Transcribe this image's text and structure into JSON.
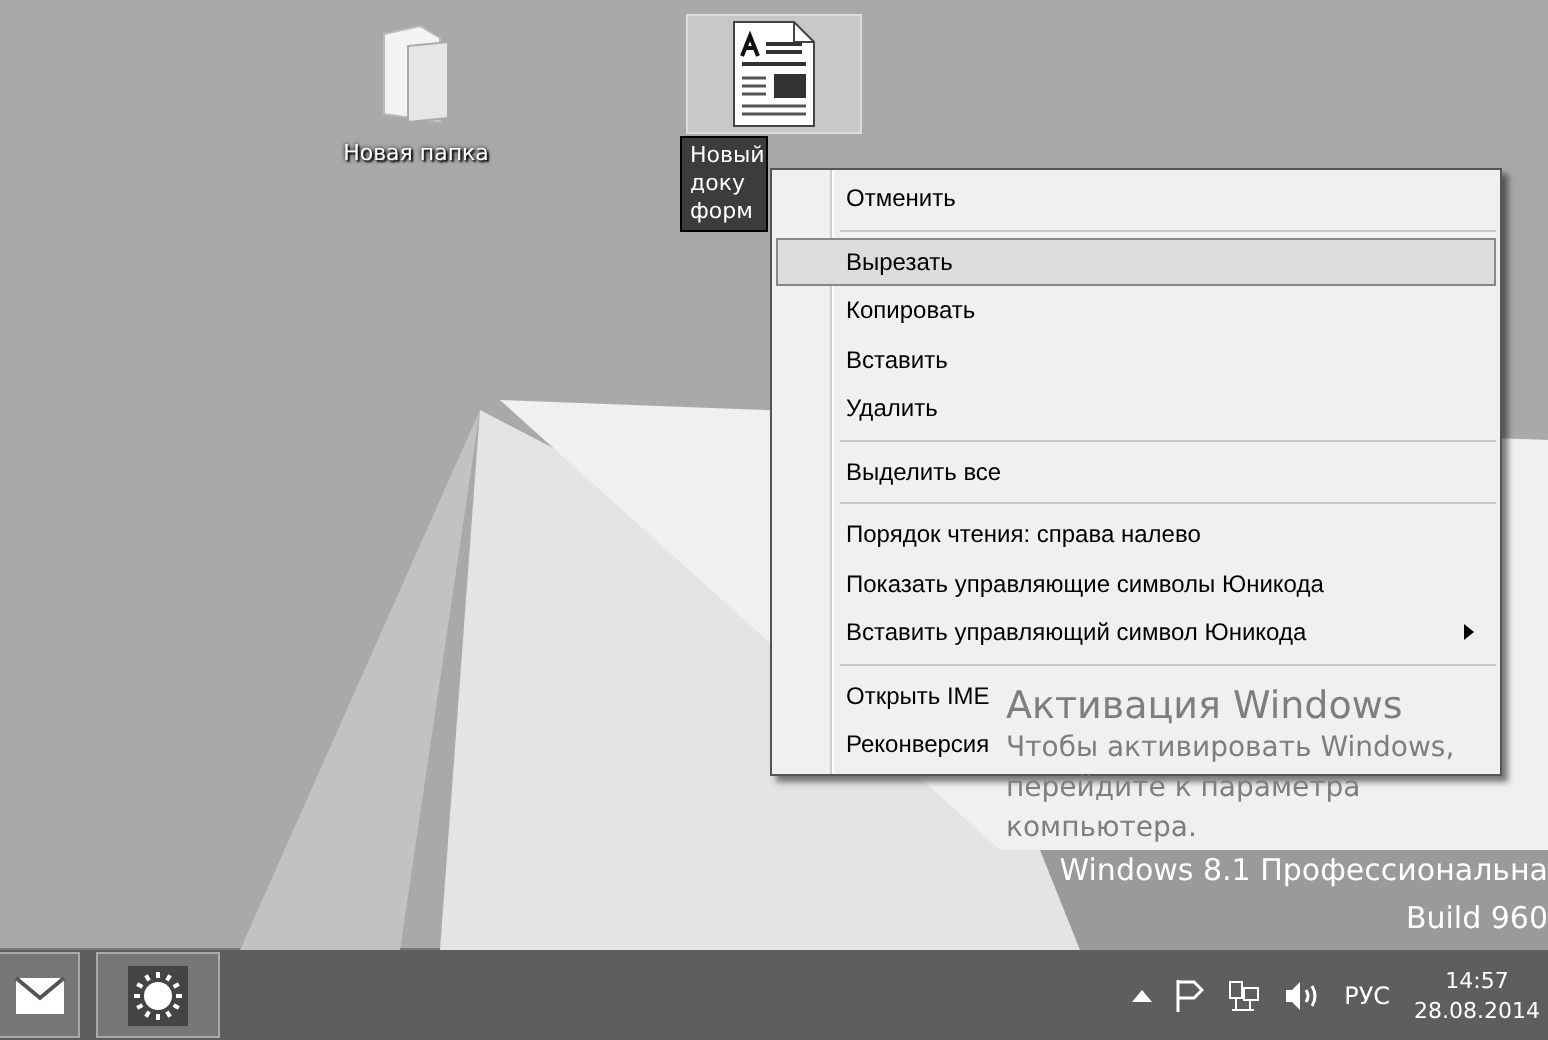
{
  "desktop": {
    "icons": [
      {
        "kind": "folder",
        "label": "Новая папка",
        "selected": false
      },
      {
        "kind": "document",
        "label": "Новый доку форм",
        "selected": true
      }
    ],
    "activation": {
      "title": "Активация Windows",
      "lines": [
        "Чтобы активировать Windows,",
        "перейдите к параметра",
        "компьютера."
      ]
    },
    "edition": {
      "name": "Windows 8.1 Профессиональна",
      "build": "Build 960"
    }
  },
  "context_menu": {
    "items": [
      {
        "kind": "item",
        "label": "Отменить",
        "selected": false,
        "submenu": false
      },
      {
        "kind": "separator"
      },
      {
        "kind": "item",
        "label": "Вырезать",
        "selected": true,
        "submenu": false
      },
      {
        "kind": "item",
        "label": "Копировать",
        "selected": false,
        "submenu": false
      },
      {
        "kind": "item",
        "label": "Вставить",
        "selected": false,
        "submenu": false
      },
      {
        "kind": "item",
        "label": "Удалить",
        "selected": false,
        "submenu": false
      },
      {
        "kind": "separator"
      },
      {
        "kind": "item",
        "label": "Выделить все",
        "selected": false,
        "submenu": false
      },
      {
        "kind": "separator"
      },
      {
        "kind": "item",
        "label": "Порядок чтения: справа налево",
        "selected": false,
        "submenu": false
      },
      {
        "kind": "item",
        "label": "Показать управляющие символы Юникода",
        "selected": false,
        "submenu": false
      },
      {
        "kind": "item",
        "label": "Вставить управляющий символ Юникода",
        "selected": false,
        "submenu": true
      },
      {
        "kind": "separator"
      },
      {
        "kind": "item",
        "label": "Открыть IME",
        "selected": false,
        "submenu": false
      },
      {
        "kind": "item",
        "label": "Реконверсия",
        "selected": false,
        "submenu": false
      }
    ]
  },
  "taskbar": {
    "apps": [
      {
        "kind": "mail"
      },
      {
        "kind": "settings"
      }
    ],
    "tray": {
      "language": "РУС",
      "time": "14:57",
      "date": "28.08.2014"
    }
  }
}
